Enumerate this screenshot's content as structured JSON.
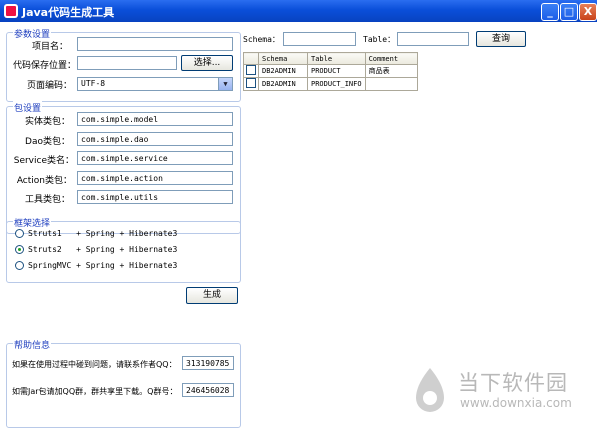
{
  "window": {
    "title": "Java代码生成工具",
    "min_label": "_",
    "max_label": "□",
    "close_label": "X"
  },
  "params": {
    "legend": "参数设置",
    "project_label": "项目名：",
    "project_value": "",
    "path_label": "代码保存位置：",
    "path_value": "",
    "choose_button": "选择...",
    "encoding_label": "页面编码：",
    "encoding_value": "UTF-8"
  },
  "packages": {
    "legend": "包设置",
    "rows": [
      {
        "label": "实体类包：",
        "value": "com.simple.model"
      },
      {
        "label": "Dao类包：",
        "value": "com.simple.dao"
      },
      {
        "label": "Service类名：",
        "value": "com.simple.service"
      },
      {
        "label": "Action类包：",
        "value": "com.simple.action"
      },
      {
        "label": "工具类包：",
        "value": "com.simple.utils"
      }
    ]
  },
  "framework": {
    "legend": "框架选择",
    "options": [
      {
        "text": "Struts1   + Spring + Hibernate3",
        "checked": false
      },
      {
        "text": "Struts2   + Spring + Hibernate3",
        "checked": true
      },
      {
        "text": "SpringMVC + Spring + Hibernate3",
        "checked": false
      }
    ]
  },
  "generate_button": "生成",
  "help": {
    "legend": "帮助信息",
    "line1": "如果在使用过程中碰到问题，请联系作者QQ：",
    "qq": "313190785",
    "line2": "如需Jar包请加QQ群，群共享里下载。Q群号：",
    "group": "246456028"
  },
  "search": {
    "schema_label": "Schema：",
    "schema_value": "",
    "table_label": "Table：",
    "table_value": "",
    "query_button": "查询"
  },
  "table": {
    "headers": [
      "Schema",
      "Table",
      "Comment"
    ],
    "rows": [
      {
        "schema": "DB2ADMIN",
        "table": "PRODUCT",
        "comment": "商品表"
      },
      {
        "schema": "DB2ADMIN",
        "table": "PRODUCT_INFO",
        "comment": ""
      }
    ]
  },
  "watermark": {
    "text": "当下软件园",
    "url": "www.downxia.com"
  }
}
